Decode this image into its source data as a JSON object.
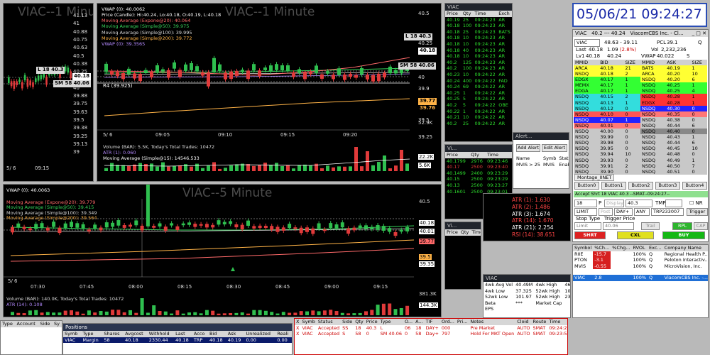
{
  "chart1": {
    "watermark": "VIAC--1 Minute",
    "prices": [
      "41.13",
      "41",
      "40.88",
      "40.75",
      "40.63",
      "40.5",
      "40.38",
      "40.25",
      "40.13",
      "40",
      "39.88",
      "39.75",
      "39.63",
      "39.5",
      "39.38",
      "39.25",
      "39.13",
      "39"
    ],
    "date": "5/ 6",
    "time": "09:15",
    "tag_l": "L 18",
    "tag_l_val": "40.3",
    "tag_sm": "SM 58",
    "tag_sm_val": "40.06",
    "tag_last": "40.18"
  },
  "chart2": {
    "watermark": "VIAC--1 Minute",
    "title": "VWAP (0): 40.0062",
    "indicators": [
      {
        "t": "Price (Candle): Hi:40.24, Lo:40.18, O:40.19, L:40.18",
        "c": "#ffffff"
      },
      {
        "t": "Moving Average (Expone@20): 40.064",
        "c": "#ff6a6a"
      },
      {
        "t": "Moving Average (Simple@50): 39.975",
        "c": "#35d35a"
      },
      {
        "t": "Moving Average (Simple@100): 39.995",
        "c": "#d8d8d8"
      },
      {
        "t": "Moving Average (Simple@200): 39.772",
        "c": "#ffb347"
      },
      {
        "t": "VWAP (0): 39.3565",
        "c": "#b48aff"
      }
    ],
    "prices": [
      "40.5",
      "40.25",
      "40.1",
      "40",
      "39.9",
      "39.75",
      "39.5",
      "39.25"
    ],
    "r4": "R4  (39.925)",
    "tag_l": "L 18",
    "tag_l_val": "40.3",
    "tag_sm": "SM 58",
    "tag_sm_val": "40.06",
    "tag_last": "40.18",
    "tag_77": "39.77",
    "tag_76": "39.76",
    "times": [
      "09:05",
      "09:10",
      "09:15",
      "09:20"
    ],
    "date": "5/ 6",
    "volume_label": "Volume (BAR): 5.5K, Today's Total Trades: 10472",
    "atr_label": "ATR (1): 0.060",
    "ma_label": "Moving Average (Simple@15): 14546.533",
    "vol_ticks": [
      "52.9K",
      "22.2K",
      "5.6K"
    ]
  },
  "chart3": {
    "watermark": "VIAC--5 Minute",
    "title": "VWAP (0): 40.0063",
    "indicators": [
      {
        "t": "Moving Average (Expone@20): 39.779",
        "c": "#ff6a6a"
      },
      {
        "t": "Moving Average (Simple@50): 39.415",
        "c": "#35d35a"
      },
      {
        "t": "Moving Average (Simple@100): 39.349",
        "c": "#d8d8d8"
      },
      {
        "t": "Moving Average (Simple@200): 39.564",
        "c": "#ffb347"
      }
    ],
    "prices": [
      "40.5",
      "40.18",
      "40.01",
      "39.77",
      "39.5",
      "39.35"
    ],
    "times": [
      "07:30",
      "07:45",
      "08:00",
      "08:15",
      "08:30",
      "08:45",
      "09:00",
      "09:15"
    ],
    "date": "5/ 6",
    "volume_label": "Volume (BAR): 140.0K, Today's Total Trades: 10472",
    "atr_label": "ATR (14): 0.108",
    "vol_ticks": [
      "381.3K",
      "144.3K"
    ]
  },
  "ts1": {
    "title": "VIAC",
    "headers": [
      "Price",
      "Qty",
      "Time",
      "Exch"
    ],
    "rows": [
      [
        "40.19",
        "25",
        "09:24:23",
        "AR"
      ],
      [
        "40.18",
        "100",
        "09:24:23",
        "AR"
      ],
      [
        "40.18",
        "25",
        "09:24:23",
        "BATS"
      ],
      [
        "40.18",
        "10",
        "09:24:23",
        "AR"
      ],
      [
        "40.18",
        "10",
        "09:24:23",
        "AR"
      ],
      [
        "40.18",
        "40",
        "09:24:23",
        "AR"
      ],
      [
        "40.18",
        "10",
        "09:24:23",
        "AR"
      ],
      [
        "40.2",
        "125",
        "09:24:23",
        "AR"
      ],
      [
        "40.2",
        "100",
        "09:24:23",
        "AR"
      ],
      [
        "40.23",
        "10",
        "09:24:22",
        "AR"
      ],
      [
        "40.24",
        "400",
        "09:24:22",
        "FAD"
      ],
      [
        "40.24",
        "69",
        "09:24:22",
        "AR"
      ],
      [
        "40.25",
        "1",
        "09:24:22",
        "AR"
      ],
      [
        "40.25",
        "5",
        "09:24:22",
        "AR"
      ],
      [
        "40.2",
        "5",
        "09:24:22",
        "OBE"
      ],
      [
        "40.22",
        "1",
        "09:24:22",
        "AR"
      ],
      [
        "40.21",
        "10",
        "09:24:22",
        "AR"
      ],
      [
        "40.2",
        "25",
        "09:24:22",
        "AR"
      ]
    ]
  },
  "ts2": {
    "title": "Vi...",
    "headers": [
      "Price",
      "Qty",
      "Time"
    ],
    "rows": [
      [
        "40.1799",
        "2976",
        "09:23:46"
      ],
      [
        "40.17",
        "2500",
        "09:23:40"
      ],
      [
        "40.1499",
        "2400",
        "09:23:29"
      ],
      [
        "40.15",
        "2500",
        "09:23:29"
      ],
      [
        "40.13",
        "2500",
        "09:23:27"
      ],
      [
        "40.1601",
        "2500",
        "09:23:01"
      ]
    ]
  },
  "ts3": {
    "title": "Vi...",
    "headers": [
      "Price",
      "Qty",
      "Time"
    ]
  },
  "alerts": {
    "title": "Alert...",
    "add": "Add Alert",
    "edit": "Edit Alert",
    "headers": [
      "Name",
      "Symb",
      "Stat"
    ],
    "row": [
      "MVIS > 25",
      "MVIS",
      "Enable"
    ]
  },
  "indpanel": {
    "rows": [
      {
        "t": "ATR (1): 1.630",
        "c": "#ff4444"
      },
      {
        "t": "ATR (2): 1.486",
        "c": "#ff4444"
      },
      {
        "t": "ATR (3): 1.674",
        "c": "#ffffff"
      },
      {
        "t": "ATR (14): 1.670",
        "c": "#ff4444"
      },
      {
        "t": "ATR (21): 2.254",
        "c": "#ffffff"
      },
      {
        "t": "RSI (14): 38.651",
        "c": "#ff4444"
      }
    ]
  },
  "clock": "05/06/21 09:24:27",
  "montage": {
    "title_sym": "VIAC",
    "title_px": "40.2 --- 40.24",
    "title_co": "ViacomCBS Inc. - Cl...",
    "symbol": "VIAC",
    "range": "48.63 - 39.11",
    "pcl_l": "PCL",
    "pcl": "39.1",
    "q": "Q",
    "last_l": "Last",
    "last": "40.18",
    "chg": "1.09",
    "chgp": "(2.8%)",
    "vol_l": "Vol",
    "vol": "2,232,236",
    "lv1_l": "Lv1",
    "lv1_b": "40.18",
    "lv1_a": "40.24",
    "vwap_l": "VWAP",
    "vwap": "40.022",
    "s": "S",
    "headers": [
      "MMID",
      "BID",
      "SIZE",
      "MMID",
      "ASK",
      "SIZE"
    ],
    "rows": [
      [
        "ARCA",
        "40.18",
        "21",
        "#ffff33",
        "BATS",
        "40.19",
        "1",
        "#ffff33"
      ],
      [
        "NSDQ",
        "40.18",
        "2",
        "#ffff33",
        "ARCA",
        "40.20",
        "10",
        "#ffff33"
      ],
      [
        "EDGX",
        "40.17",
        "1",
        "#33ff33",
        "NSDQ",
        "40.20",
        "6",
        "#ffff33"
      ],
      [
        "MEMX",
        "40.17",
        "1",
        "#33ff33",
        "NSDQ",
        "40.25",
        "1",
        "#33ff33"
      ],
      [
        "EDGA",
        "40.17",
        "1",
        "#33ff33",
        "NSDQ",
        "40.25",
        "4",
        "#33ff33"
      ],
      [
        "NSDQ",
        "40.15",
        "2",
        "#33dddd",
        "NSDQ",
        "40.28",
        "1",
        "#ff3333"
      ],
      [
        "NSDQ",
        "40.13",
        "1",
        "#33dddd",
        "EDGX",
        "40.28",
        "1",
        "#ff3333"
      ],
      [
        "NSDQ",
        "40.12",
        "0",
        "#33dddd",
        "NSDQ",
        "40.30",
        "0",
        "#2222ff"
      ],
      [
        "NSDQ",
        "40.10",
        "0",
        "#ff5555",
        "NSDQ",
        "40.35",
        "0",
        "#ff7777"
      ],
      [
        "NSDQ",
        "40.07",
        "1",
        "#2222ff",
        "NSDQ",
        "40.38",
        "0",
        "#c8c8c8"
      ],
      [
        "NSDQ",
        "40.01",
        "0",
        "#ff7777",
        "NSDQ",
        "40.44",
        "6",
        "#c8c8c8"
      ],
      [
        "NSDQ",
        "40.00",
        "0",
        "#c8c8c8",
        "NSDQ",
        "40.40",
        "0",
        "#888888"
      ],
      [
        "NSDQ",
        "39.99",
        "0",
        "#c8c8c8",
        "NSDQ",
        "40.43",
        "1",
        "#c8c8c8"
      ],
      [
        "NSDQ",
        "39.98",
        "0",
        "#c8c8c8",
        "NSDQ",
        "40.44",
        "6",
        "#c8c8c8"
      ],
      [
        "NSDQ",
        "39.95",
        "0",
        "#c8c8c8",
        "NSDQ",
        "40.45",
        "10",
        "#c8c8c8"
      ],
      [
        "NSDQ",
        "39.94",
        "10",
        "#c8c8c8",
        "NSDQ",
        "40.48",
        "0",
        "#c8c8c8"
      ],
      [
        "NSDQ",
        "39.93",
        "0",
        "#c8c8c8",
        "NSDQ",
        "40.49",
        "1",
        "#c8c8c8"
      ],
      [
        "NSDQ",
        "39.91",
        "2",
        "#c8c8c8",
        "NSDQ",
        "40.50",
        "7",
        "#c8c8c8"
      ],
      [
        "NSDQ",
        "39.90",
        "0",
        "#c8c8c8",
        "NSDQ",
        "40.51",
        "0",
        "#c8c8c8"
      ]
    ],
    "tab": "Montage_IINET",
    "buttons": [
      "Button0",
      "Button1",
      "Button2",
      "Button3",
      "Button4"
    ],
    "accept": "Accept Shrt 18 VIAC 40.3 --SMAT--09:24:27--",
    "qty": "18",
    "p": "P",
    "display": "Display",
    "price": "40.3",
    "tmp": "TMP",
    "nr": "NR",
    "type": "LIMIT",
    "post": "Post",
    "tif": "DAY+",
    "any": "ANY",
    "route": "TRP233007",
    "trigger": "Trigger",
    "pd": "PD",
    "stop_type": "Stop Type",
    "trig_price": "Trigger Price",
    "stop_sel": "Limit",
    "stop_px": "40.06",
    "trail": "Trail",
    "rpl": "RPL",
    "cap": "CAP",
    "shrt": "SHRT",
    "cxl": "CXL",
    "buy": "BUY"
  },
  "watch": {
    "headers": [
      "Symbol",
      "%Ch...",
      "%Chg...",
      "RVOL",
      "Exc...",
      "Company Name",
      "Volu"
    ],
    "rows": [
      [
        "RIIE",
        "-15.7",
        "",
        "100%",
        "Q",
        "Regional Health P...",
        "364,6"
      ],
      [
        "PTON",
        "-3.1",
        "",
        "100%",
        "Q",
        "Peloton Interactiv...",
        "669,6"
      ],
      [
        "MVIS",
        "-0.55",
        "",
        "100%",
        "Q",
        "MicroVision, Inc.",
        "287,9"
      ]
    ],
    "sel": [
      "VIAC",
      "2.8",
      "",
      "100%",
      "Q",
      "ViacomCBS Inc. -...",
      "2,228"
    ]
  },
  "fund": {
    "title": "VIAC",
    "rows": [
      [
        "4wk Avg Vol",
        "40.49M",
        "4wk High",
        "46"
      ],
      [
        "4wk Low",
        "37.325",
        "52wk High",
        "101"
      ],
      [
        "52wk Low",
        "101.97",
        "52wk High",
        "23.50"
      ],
      [
        "Beta",
        "***",
        "Market Cap",
        ""
      ],
      [
        "EPS",
        "",
        "",
        ""
      ]
    ]
  },
  "positions": {
    "title": "Positions",
    "headers": [
      "Symb",
      "Type",
      "Shares",
      "Avgcost",
      "Withhold",
      "Last",
      "Acco",
      "Bid",
      "Ask",
      "Unrealized",
      "Reali"
    ],
    "row": [
      "VIAC",
      "Margin",
      "58",
      "40.18",
      "2330.44",
      "40.18",
      "TRP",
      "40.18",
      "40.19",
      "0.00",
      "0.00"
    ]
  },
  "account": {
    "headers": [
      "Type",
      "Account",
      "Side",
      "Sy"
    ]
  },
  "orders": {
    "headers": [
      "X",
      "Symb",
      "Status",
      "Side",
      "Qty",
      "Price",
      "Type",
      "O...",
      "A...",
      "TIF",
      "Ord...",
      "Pri...",
      "Notes",
      "Cloid",
      "Route",
      "Time"
    ],
    "rows": [
      [
        "X",
        "VIAC",
        "Accepted",
        "SS",
        "18",
        "40.3",
        "L",
        "06",
        "18",
        "DAY+",
        "000",
        "",
        "Pre Market",
        "AUTO",
        "SMAT",
        "09:24:27"
      ],
      [
        "X",
        "VIAC",
        "Accepted",
        "S",
        "58",
        "0",
        "SM 40.06",
        "0",
        "58",
        "Day+",
        "797",
        "",
        "Hold For MKT Open",
        "AUTO",
        "SMAT",
        "09:23:50"
      ]
    ]
  }
}
